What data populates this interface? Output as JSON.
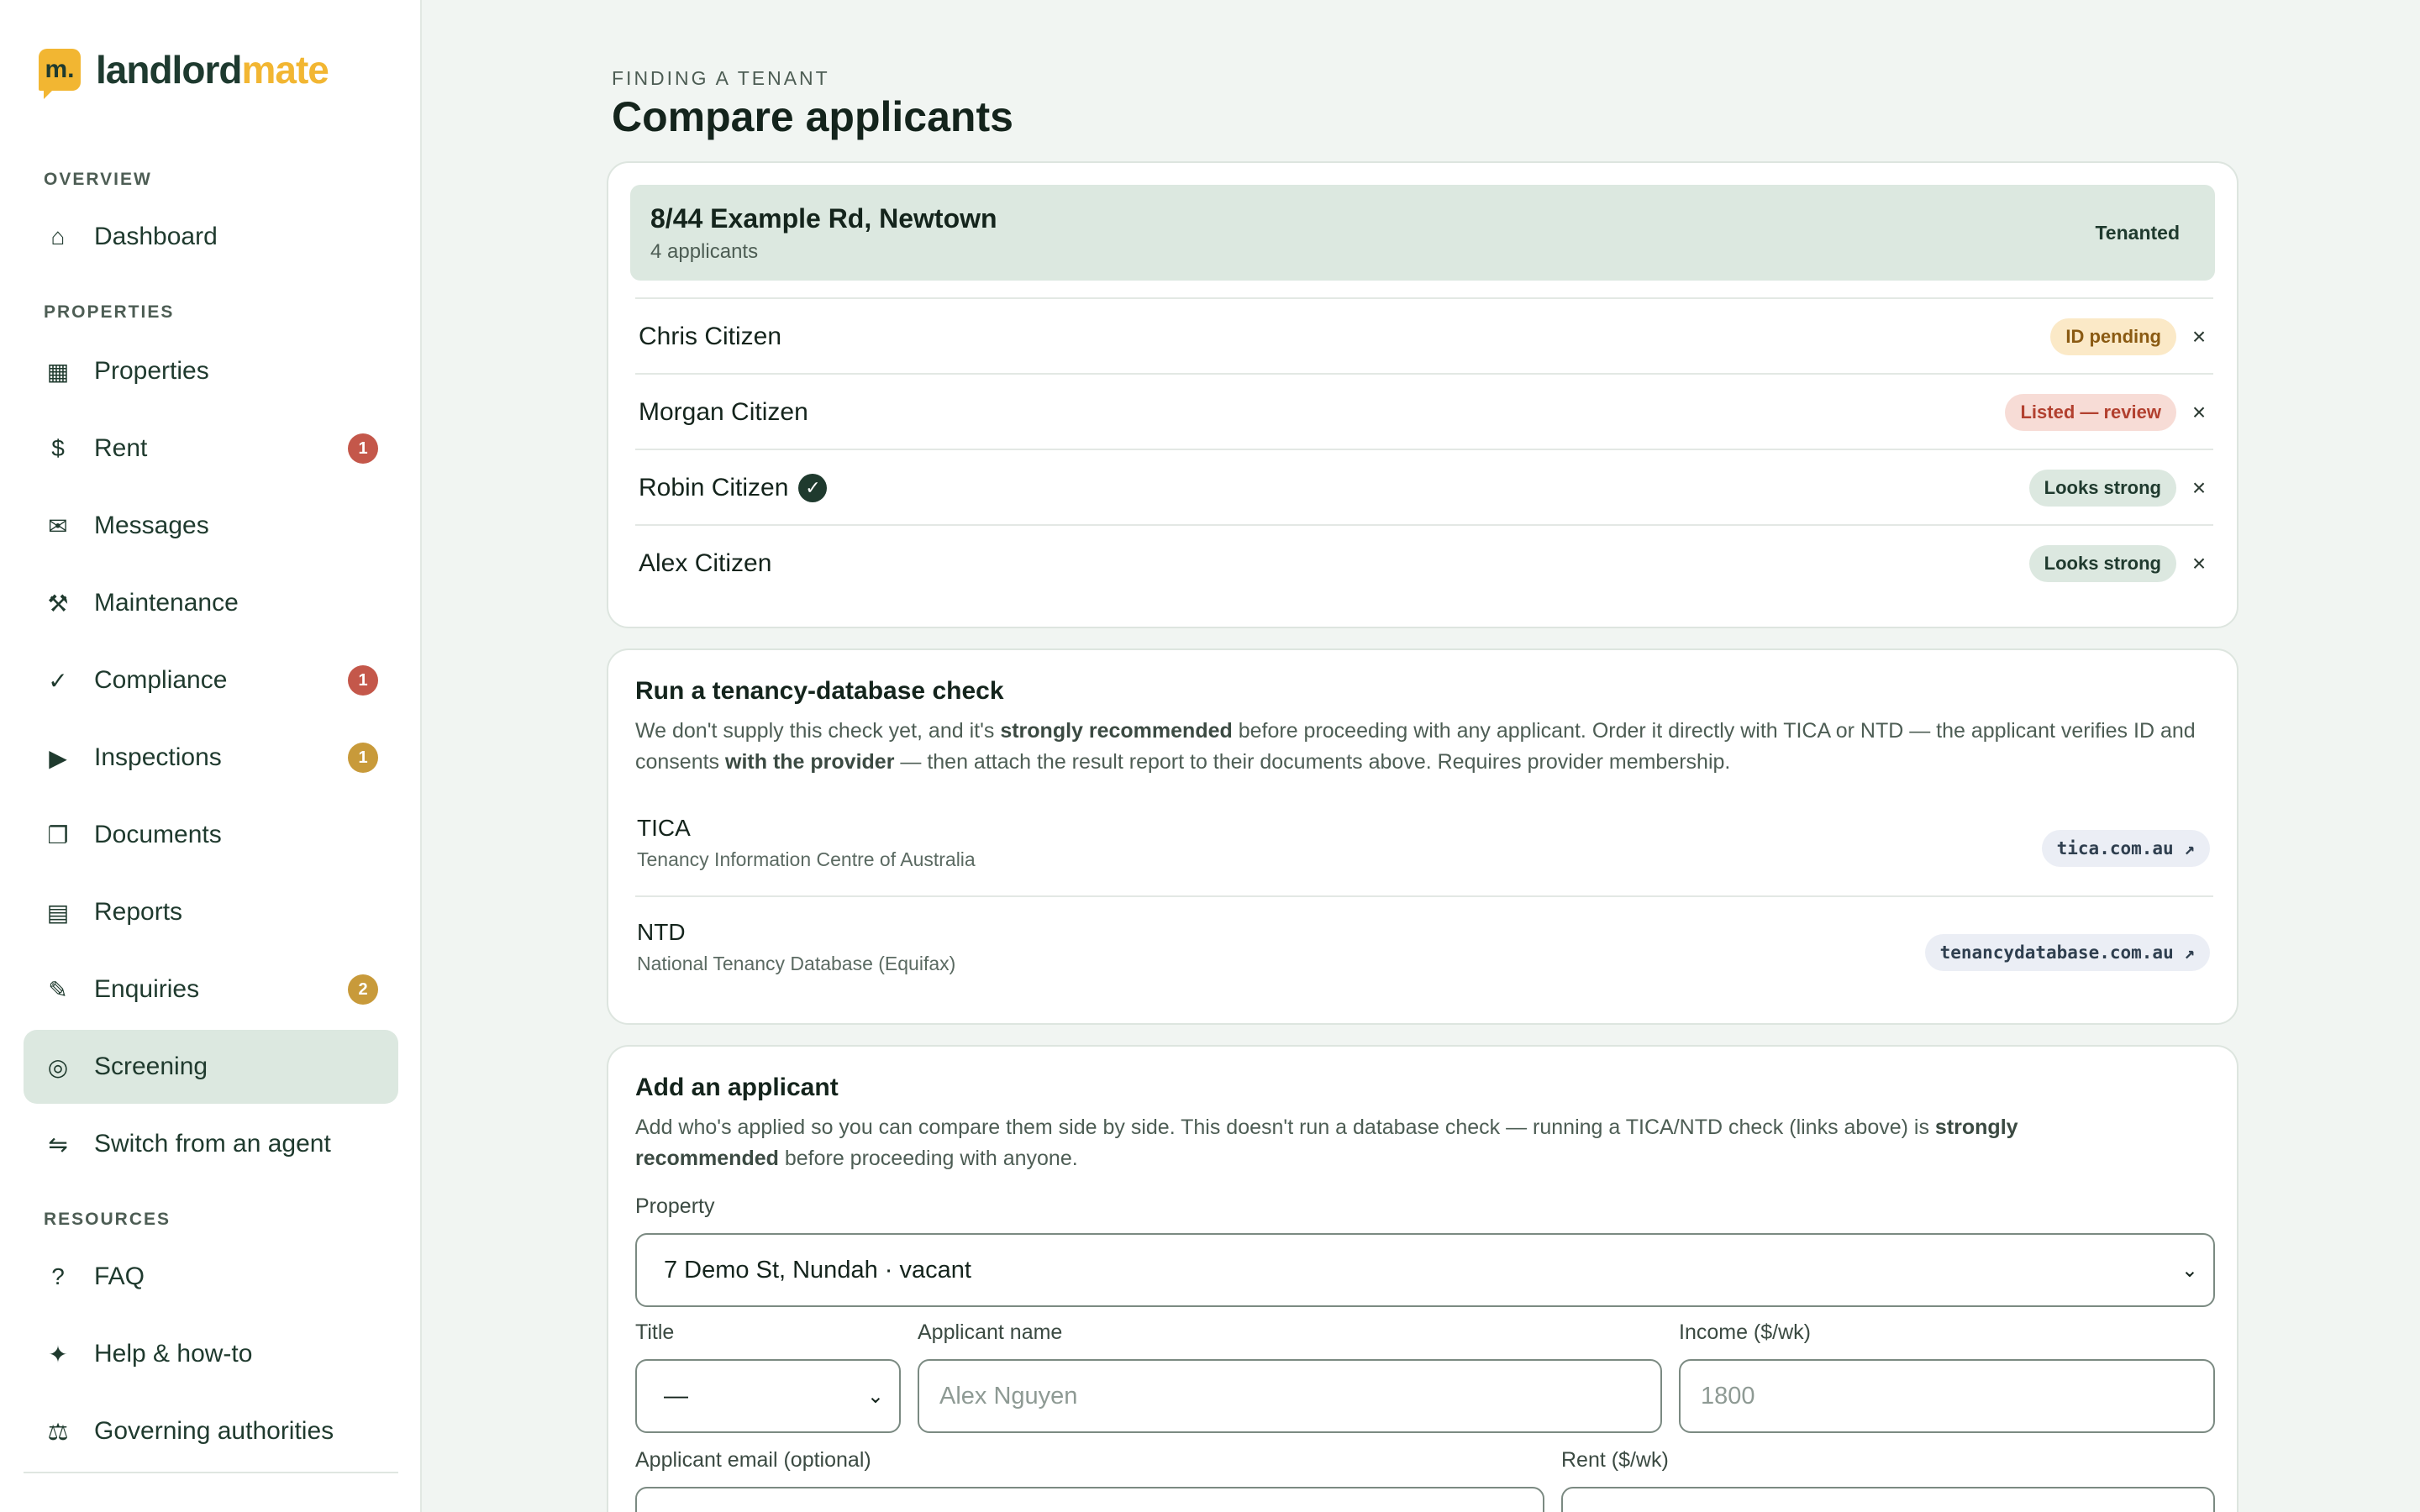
{
  "brand": {
    "mark": "m.",
    "name_a": "landlord",
    "name_b": "mate"
  },
  "sidebar": {
    "sections": [
      "OVERVIEW",
      "PROPERTIES",
      "RESOURCES"
    ],
    "items": [
      {
        "label": "Dashboard",
        "icon": "⌂"
      },
      {
        "label": "Properties",
        "icon": "▦"
      },
      {
        "label": "Rent",
        "icon": "$",
        "badge": "1"
      },
      {
        "label": "Messages",
        "icon": "✉"
      },
      {
        "label": "Maintenance",
        "icon": "⚒"
      },
      {
        "label": "Compliance",
        "icon": "✓",
        "badge": "1"
      },
      {
        "label": "Inspections",
        "icon": "▶",
        "badge": "1"
      },
      {
        "label": "Documents",
        "icon": "❐"
      },
      {
        "label": "Reports",
        "icon": "▤"
      },
      {
        "label": "Enquiries",
        "icon": "✎",
        "badge": "2"
      },
      {
        "label": "Screening",
        "icon": "◎"
      },
      {
        "label": "Switch from an agent",
        "icon": "⇋"
      },
      {
        "label": "FAQ",
        "icon": "?"
      },
      {
        "label": "Help & how-to",
        "icon": "✦"
      },
      {
        "label": "Governing authorities",
        "icon": "⚖"
      }
    ]
  },
  "header": {
    "eyebrow": "FINDING A TENANT",
    "title": "Compare applicants"
  },
  "property": {
    "title": "8/44 Example Rd, Newtown",
    "sub": "4 applicants",
    "status": "Tenanted"
  },
  "applicants": [
    {
      "name": "Chris Citizen",
      "status": "ID pending",
      "remove": "×"
    },
    {
      "name": "Morgan Citizen",
      "status": "Listed — review",
      "remove": "×"
    },
    {
      "name": "Robin Citizen",
      "status": "Looks strong",
      "remove": "×",
      "verified": "✓"
    },
    {
      "name": "Alex Citizen",
      "status": "Looks strong",
      "remove": "×"
    }
  ],
  "db_check": {
    "title": "Run a tenancy-database check",
    "p1": "We don't supply this check yet, and it's ",
    "b1": "strongly recommended",
    "p2": " before proceeding with any applicant. Order it directly with TICA or NTD — the applicant verifies ID and consents ",
    "b2": "with the provider",
    "p3": " — then attach the result report to their documents above. Requires provider membership.",
    "providers": [
      {
        "name": "TICA",
        "full": "Tenancy Information Centre of Australia",
        "link": "tica.com.au ↗"
      },
      {
        "name": "NTD",
        "full": "National Tenancy Database (Equifax)",
        "link": "tenancydatabase.com.au ↗"
      }
    ]
  },
  "add_applicant": {
    "title": "Add an applicant",
    "p1": "Add who's applied so you can compare them side by side. This doesn't run a database check — running a TICA/NTD check (links above) is ",
    "b1": "strongly recommended",
    "p2": " before proceeding with anyone.",
    "property_label": "Property",
    "property_value": "7 Demo St, Nundah · vacant",
    "title_label": "Title",
    "title_value": "—",
    "name_label": "Applicant name",
    "name_placeholder": "Alex Nguyen",
    "income_label": "Income ($/wk)",
    "income_placeholder": "1800",
    "email_label": "Applicant email (optional)",
    "rent_label": "Rent ($/wk)"
  },
  "colors": {
    "accent": "#f2b632",
    "primary": "#1f3a2e",
    "active_bg": "#dce8e0",
    "alert": "#c4574a",
    "warn": "#c89a3a"
  }
}
